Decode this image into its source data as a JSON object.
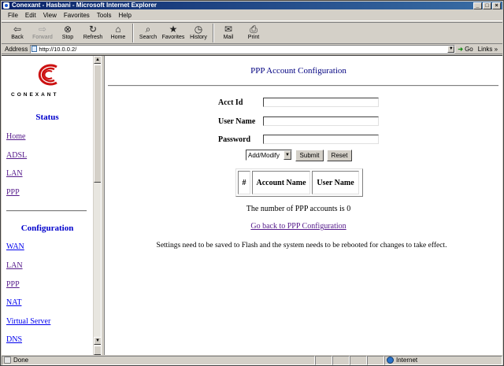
{
  "window": {
    "title": "Conexant - Hasbani - Microsoft Internet Explorer",
    "controls": [
      "_",
      "□",
      "×"
    ]
  },
  "menu": [
    "File",
    "Edit",
    "View",
    "Favorites",
    "Tools",
    "Help"
  ],
  "toolbar": [
    {
      "label": "Back",
      "icon": "back-arrow-icon",
      "enabled": true
    },
    {
      "label": "Forward",
      "icon": "forward-arrow-icon",
      "enabled": false
    },
    {
      "label": "Stop",
      "icon": "stop-icon",
      "enabled": true
    },
    {
      "label": "Refresh",
      "icon": "refresh-icon",
      "enabled": true
    },
    {
      "label": "Home",
      "icon": "home-icon",
      "enabled": true
    },
    {
      "label": "Search",
      "icon": "search-icon",
      "enabled": true
    },
    {
      "label": "Favorites",
      "icon": "favorites-icon",
      "enabled": true
    },
    {
      "label": "History",
      "icon": "history-icon",
      "enabled": true
    },
    {
      "label": "Mail",
      "icon": "mail-icon",
      "enabled": true
    },
    {
      "label": "Print",
      "icon": "print-icon",
      "enabled": true
    }
  ],
  "address": {
    "label": "Address",
    "url": "http://10.0.0.2/",
    "go_label": "Go",
    "links_label": "Links"
  },
  "left_nav": {
    "brand": "CONEXANT",
    "status_heading": "Status",
    "status_links": [
      "Home",
      "ADSL",
      "LAN",
      "PPP"
    ],
    "config_heading": "Configuration",
    "config_links": [
      "WAN",
      "LAN",
      "PPP",
      "NAT",
      "Virtual Server",
      "DNS"
    ]
  },
  "main": {
    "title": "PPP Account Configuration",
    "fields": [
      {
        "label": "Acct Id",
        "value": ""
      },
      {
        "label": "User Name",
        "value": ""
      },
      {
        "label": "Password",
        "value": ""
      }
    ],
    "action_select": "Add/Modify",
    "submit_label": "Submit",
    "reset_label": "Reset",
    "table_headers": [
      "#",
      "Account Name",
      "User Name"
    ],
    "count_text": "The number of PPP accounts is 0",
    "back_link": "Go back to PPP Configuration",
    "note": "Settings need to be saved to Flash and the system needs to be rebooted for changes to take effect."
  },
  "status_bar": {
    "left": "Done",
    "zone": "Internet"
  },
  "colors": {
    "title_gradient_start": "#0a246a",
    "link_visited": "#551a8b",
    "link_unvisited": "#0000ee",
    "heading_blue": "#0000cc",
    "logo_red": "#cc1111"
  }
}
